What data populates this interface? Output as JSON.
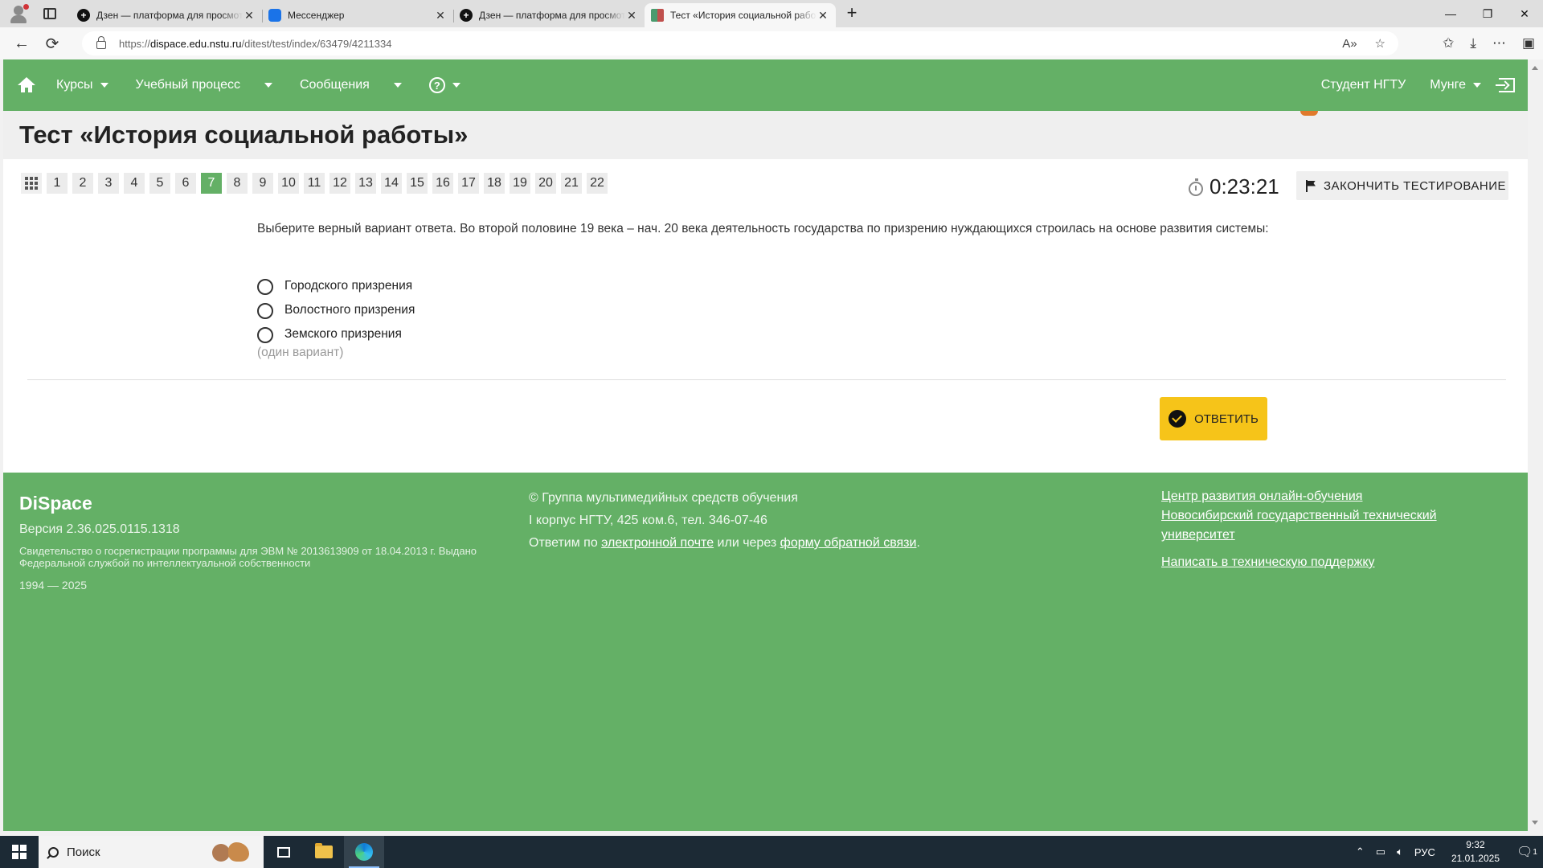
{
  "browser": {
    "tabs": [
      {
        "title": "Дзен — платформа для просмотра",
        "active": false
      },
      {
        "title": "Мессенджер",
        "active": false
      },
      {
        "title": "Дзен — платформа для просмотра",
        "active": false
      },
      {
        "title": "Тест «История социальной работы»",
        "active": true
      }
    ],
    "url_prefix": "https://",
    "url_host": "dispace.edu.nstu.ru",
    "url_path": "/ditest/test/index/63479/4211334"
  },
  "nav": {
    "courses": "Курсы",
    "study": "Учебный процесс",
    "messages": "Сообщения",
    "help": "?",
    "user_role": "Студент НГТУ",
    "user_name": "Мунге"
  },
  "page": {
    "title": "Тест «История социальной работы»"
  },
  "question_nav": {
    "numbers": [
      "1",
      "2",
      "3",
      "4",
      "5",
      "6",
      "7",
      "8",
      "9",
      "10",
      "11",
      "12",
      "13",
      "14",
      "15",
      "16",
      "17",
      "18",
      "19",
      "20",
      "21",
      "22"
    ],
    "current": "7"
  },
  "timer": "0:23:21",
  "finish_label": "ЗАКОНЧИТЬ ТЕСТИРОВАНИЕ",
  "question": {
    "text": "Выберите верный вариант ответа. Во второй половине 19 века – нач. 20 века деятельность государства по призрению нуждающихся строилась на основе развития системы:",
    "options": [
      "Городского призрения",
      "Волостного призрения",
      "Земского призрения"
    ],
    "hint": "(один вариант)"
  },
  "answer_label": "ОТВЕТИТЬ",
  "footer": {
    "logo": "DiSpace",
    "version": "Версия 2.36.025.0115.1318",
    "cert": "Свидетельство о госрегистрации программы для ЭВМ № 2013613909 от 18.04.2013 г. Выдано Федеральной службой по интеллектуальной собственности",
    "years": "1994 — 2025",
    "group": "© Группа мультимедийных средств обучения",
    "address": "I корпус НГТУ, 425 ком.6, тел. 346-07-46",
    "contact_prefix": "Ответим по ",
    "email_link": "электронной почте",
    "contact_mid": " или через ",
    "form_link": "форму обратной связи",
    "contact_suffix": ".",
    "link_center": "Центр развития онлайн-обучения",
    "link_university": "Новосибирский государственный технический университет",
    "link_support": "Написать в техническую поддержку"
  },
  "taskbar": {
    "search_placeholder": "Поиск",
    "lang": "РУС",
    "time": "9:32",
    "date": "21.01.2025",
    "notif_count": "1"
  }
}
